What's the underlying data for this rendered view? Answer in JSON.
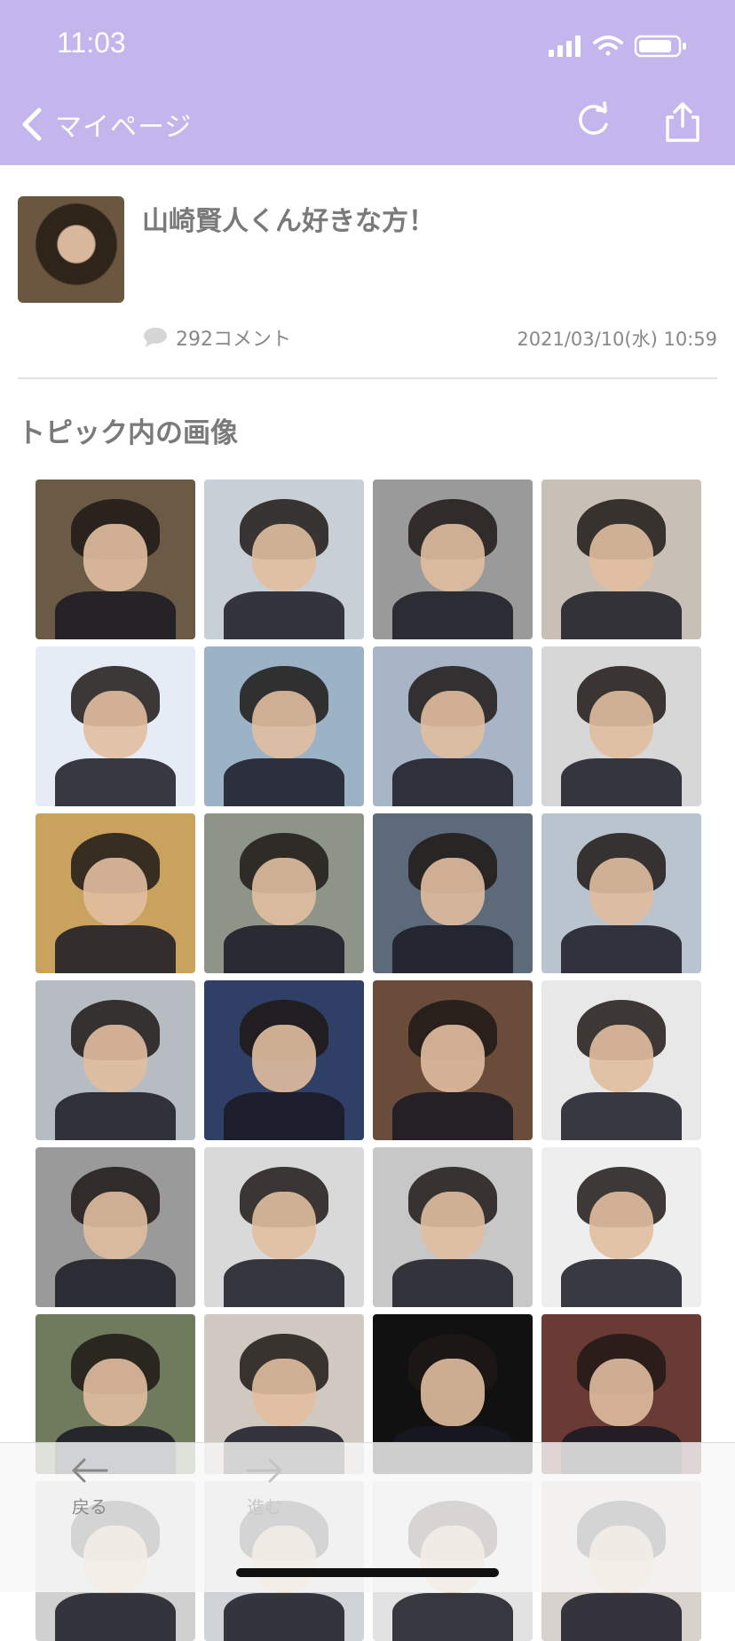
{
  "status_bar": {
    "time": "11:03",
    "icons": [
      "signal-icon",
      "wifi-icon",
      "battery-icon"
    ]
  },
  "nav": {
    "back_label": "マイページ",
    "reload_icon": "reload-icon",
    "share_icon": "share-icon",
    "bar_color": "#c4b6ec"
  },
  "topic": {
    "title": "山崎賢人くん好きな方！",
    "comments": "292コメント",
    "date": "2021/03/10(水) 10:59"
  },
  "section": {
    "title": "トピック内の画像"
  },
  "images": [
    {
      "bg": "#6b5a45"
    },
    {
      "bg": "#c9cfd6"
    },
    {
      "bg": "#9a9a9a"
    },
    {
      "bg": "#c8c0b6"
    },
    {
      "bg": "#e6ecf5"
    },
    {
      "bg": "#9cb2c6"
    },
    {
      "bg": "#a7b5c6"
    },
    {
      "bg": "#d7d7d7"
    },
    {
      "bg": "#c9a25e"
    },
    {
      "bg": "#8e9488"
    },
    {
      "bg": "#5c6a7a"
    },
    {
      "bg": "#b9c4cf"
    },
    {
      "bg": "#b7bcc2"
    },
    {
      "bg": "#2f3f66"
    },
    {
      "bg": "#6a4c3a"
    },
    {
      "bg": "#e8e8e8"
    },
    {
      "bg": "#9a9a9a"
    },
    {
      "bg": "#d9d9d9"
    },
    {
      "bg": "#c7c7c7"
    },
    {
      "bg": "#eeeeee"
    },
    {
      "bg": "#6f7b5c"
    },
    {
      "bg": "#cfc9c2"
    },
    {
      "bg": "#111111"
    },
    {
      "bg": "#6a3a34"
    },
    {
      "bg": "#d0d0d0"
    },
    {
      "bg": "#cfd2d6"
    },
    {
      "bg": "#e2e2e2"
    },
    {
      "bg": "#d8d2cc"
    }
  ],
  "toolbar": {
    "back_label": "戻る",
    "forward_label": "進む"
  }
}
